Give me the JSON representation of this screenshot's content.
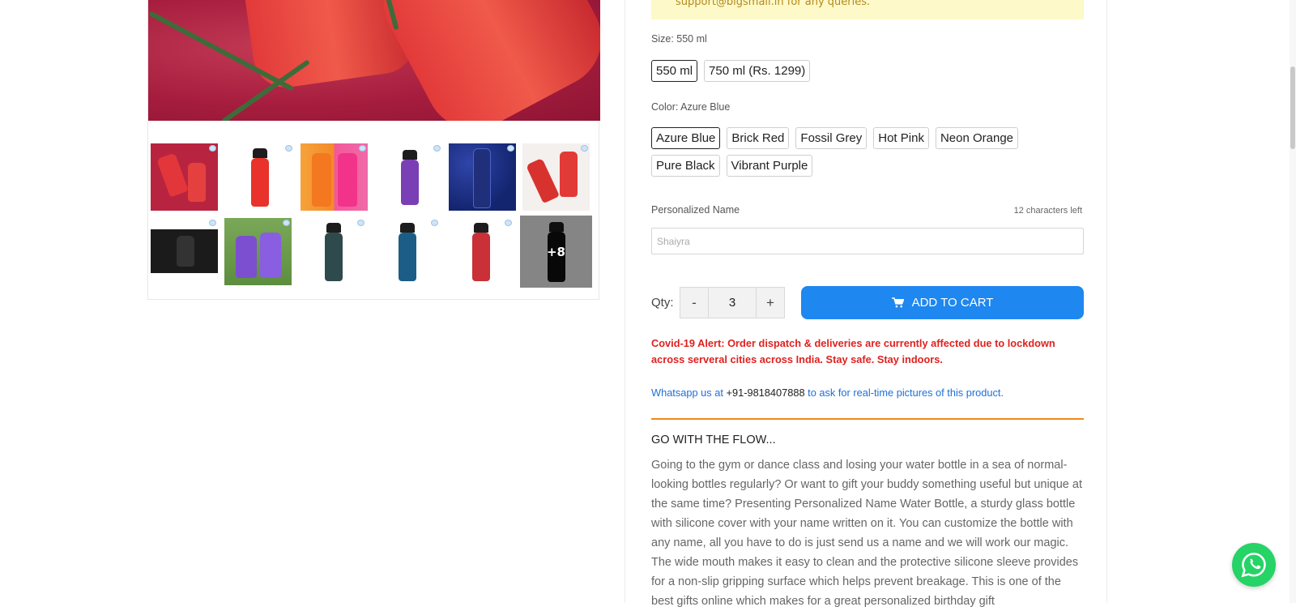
{
  "notice": {
    "text": "support@bigsmall.in for any queries."
  },
  "gallery": {
    "more_count": "+8"
  },
  "size": {
    "label": "Size: 550 ml",
    "options": [
      "550 ml",
      "750 ml (Rs. 1299)"
    ],
    "selected": "550 ml"
  },
  "color": {
    "label": "Color: Azure Blue",
    "options": [
      "Azure Blue",
      "Brick Red",
      "Fossil Grey",
      "Hot Pink",
      "Neon Orange",
      "Pure Black",
      "Vibrant Purple"
    ],
    "selected": "Azure Blue"
  },
  "personalized": {
    "label": "Personalized Name",
    "chars_left": "12 characters left",
    "placeholder": "Shaiyra"
  },
  "qty": {
    "label": "Qty:",
    "minus": "-",
    "value": "3",
    "plus": "+"
  },
  "cart": {
    "label": "ADD TO CART",
    "icon": "cart-icon"
  },
  "covid_alert": "Covid-19 Alert: Order dispatch & deliveries are currently affected due to lockdown across serveral cities across India. Stay safe. Stay indoors.",
  "whatsapp": {
    "prefix": "Whatsapp us at ",
    "number": "+91-9818407888",
    "suffix": " to ask for real-time pictures of this product."
  },
  "description": {
    "title": "GO WITH THE FLOW...",
    "body": "Going to the gym or dance class and losing your water bottle in a sea of normal-looking bottles regularly? Or want to gift your buddy something useful but unique at the same time? Presenting Personalized Name Water Bottle, a sturdy glass bottle with silicone cover with your name written on it. You can customize the bottle with any name, all you have to do is just send us a name and we will work our magic. The wide mouth makes it easy to clean and the protective silicone sleeve provides for a non-slip gripping surface which helps prevent breakage. This is one of the best gifts online which makes for a great personalized birthday gift"
  },
  "colors": {
    "accent": "#1e87f0",
    "alert": "#e0211f",
    "divider": "#f08a1c",
    "notice_bg": "#fdf9c8",
    "whatsapp": "#25d366"
  }
}
